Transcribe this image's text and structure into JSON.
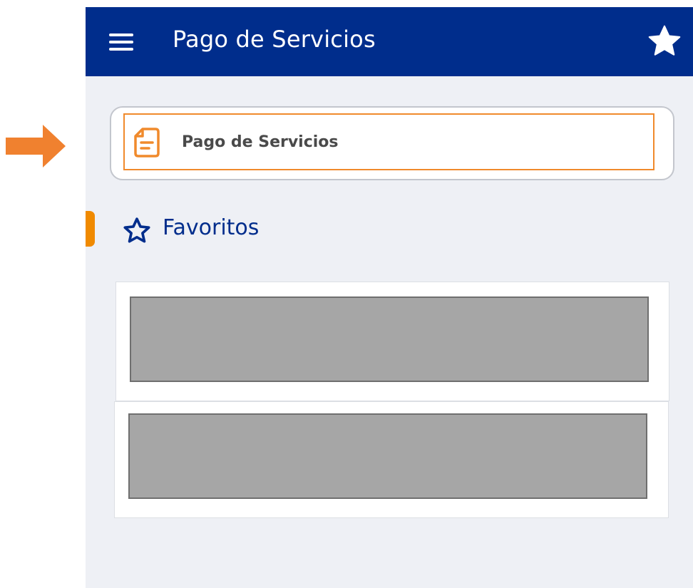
{
  "app_bar": {
    "title": "Pago de Servicios",
    "menu_icon": "hamburger-menu-icon",
    "favorite_icon": "star-filled-icon"
  },
  "service_option": {
    "label": "Pago de Servicios",
    "icon": "document-icon"
  },
  "favorites_section": {
    "title": "Favoritos",
    "icon": "star-outline-icon"
  },
  "favorites": [
    {
      "content": "redacted"
    },
    {
      "content": "redacted"
    }
  ],
  "colors": {
    "primary": "#002d8c",
    "accent": "#f08a2c",
    "background": "#eef0f5",
    "redacted": "#a6a6a6"
  }
}
